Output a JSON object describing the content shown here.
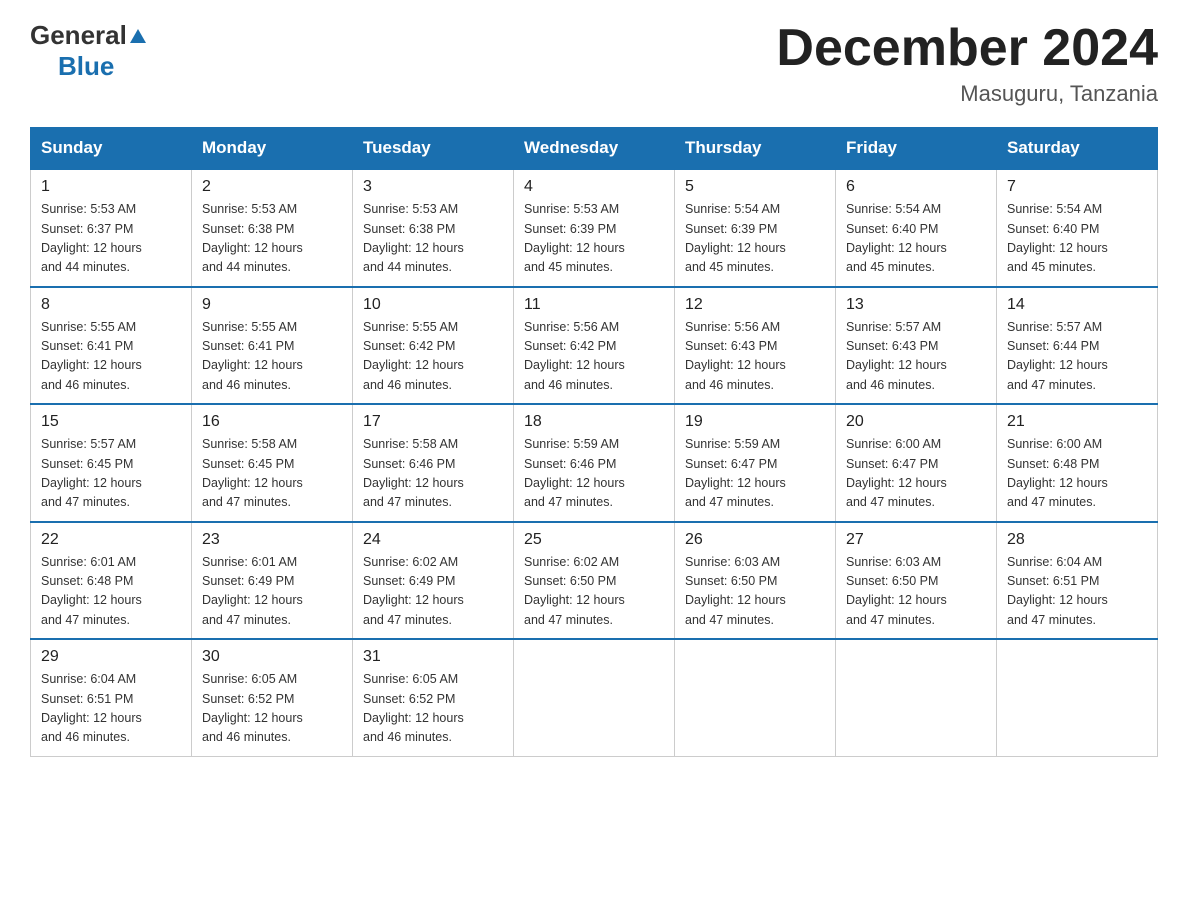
{
  "header": {
    "logo_general": "General",
    "logo_blue": "Blue",
    "month_year": "December 2024",
    "location": "Masuguru, Tanzania"
  },
  "columns": [
    "Sunday",
    "Monday",
    "Tuesday",
    "Wednesday",
    "Thursday",
    "Friday",
    "Saturday"
  ],
  "weeks": [
    [
      {
        "day": "1",
        "sunrise": "5:53 AM",
        "sunset": "6:37 PM",
        "daylight": "12 hours and 44 minutes."
      },
      {
        "day": "2",
        "sunrise": "5:53 AM",
        "sunset": "6:38 PM",
        "daylight": "12 hours and 44 minutes."
      },
      {
        "day": "3",
        "sunrise": "5:53 AM",
        "sunset": "6:38 PM",
        "daylight": "12 hours and 44 minutes."
      },
      {
        "day": "4",
        "sunrise": "5:53 AM",
        "sunset": "6:39 PM",
        "daylight": "12 hours and 45 minutes."
      },
      {
        "day": "5",
        "sunrise": "5:54 AM",
        "sunset": "6:39 PM",
        "daylight": "12 hours and 45 minutes."
      },
      {
        "day": "6",
        "sunrise": "5:54 AM",
        "sunset": "6:40 PM",
        "daylight": "12 hours and 45 minutes."
      },
      {
        "day": "7",
        "sunrise": "5:54 AM",
        "sunset": "6:40 PM",
        "daylight": "12 hours and 45 minutes."
      }
    ],
    [
      {
        "day": "8",
        "sunrise": "5:55 AM",
        "sunset": "6:41 PM",
        "daylight": "12 hours and 46 minutes."
      },
      {
        "day": "9",
        "sunrise": "5:55 AM",
        "sunset": "6:41 PM",
        "daylight": "12 hours and 46 minutes."
      },
      {
        "day": "10",
        "sunrise": "5:55 AM",
        "sunset": "6:42 PM",
        "daylight": "12 hours and 46 minutes."
      },
      {
        "day": "11",
        "sunrise": "5:56 AM",
        "sunset": "6:42 PM",
        "daylight": "12 hours and 46 minutes."
      },
      {
        "day": "12",
        "sunrise": "5:56 AM",
        "sunset": "6:43 PM",
        "daylight": "12 hours and 46 minutes."
      },
      {
        "day": "13",
        "sunrise": "5:57 AM",
        "sunset": "6:43 PM",
        "daylight": "12 hours and 46 minutes."
      },
      {
        "day": "14",
        "sunrise": "5:57 AM",
        "sunset": "6:44 PM",
        "daylight": "12 hours and 47 minutes."
      }
    ],
    [
      {
        "day": "15",
        "sunrise": "5:57 AM",
        "sunset": "6:45 PM",
        "daylight": "12 hours and 47 minutes."
      },
      {
        "day": "16",
        "sunrise": "5:58 AM",
        "sunset": "6:45 PM",
        "daylight": "12 hours and 47 minutes."
      },
      {
        "day": "17",
        "sunrise": "5:58 AM",
        "sunset": "6:46 PM",
        "daylight": "12 hours and 47 minutes."
      },
      {
        "day": "18",
        "sunrise": "5:59 AM",
        "sunset": "6:46 PM",
        "daylight": "12 hours and 47 minutes."
      },
      {
        "day": "19",
        "sunrise": "5:59 AM",
        "sunset": "6:47 PM",
        "daylight": "12 hours and 47 minutes."
      },
      {
        "day": "20",
        "sunrise": "6:00 AM",
        "sunset": "6:47 PM",
        "daylight": "12 hours and 47 minutes."
      },
      {
        "day": "21",
        "sunrise": "6:00 AM",
        "sunset": "6:48 PM",
        "daylight": "12 hours and 47 minutes."
      }
    ],
    [
      {
        "day": "22",
        "sunrise": "6:01 AM",
        "sunset": "6:48 PM",
        "daylight": "12 hours and 47 minutes."
      },
      {
        "day": "23",
        "sunrise": "6:01 AM",
        "sunset": "6:49 PM",
        "daylight": "12 hours and 47 minutes."
      },
      {
        "day": "24",
        "sunrise": "6:02 AM",
        "sunset": "6:49 PM",
        "daylight": "12 hours and 47 minutes."
      },
      {
        "day": "25",
        "sunrise": "6:02 AM",
        "sunset": "6:50 PM",
        "daylight": "12 hours and 47 minutes."
      },
      {
        "day": "26",
        "sunrise": "6:03 AM",
        "sunset": "6:50 PM",
        "daylight": "12 hours and 47 minutes."
      },
      {
        "day": "27",
        "sunrise": "6:03 AM",
        "sunset": "6:50 PM",
        "daylight": "12 hours and 47 minutes."
      },
      {
        "day": "28",
        "sunrise": "6:04 AM",
        "sunset": "6:51 PM",
        "daylight": "12 hours and 47 minutes."
      }
    ],
    [
      {
        "day": "29",
        "sunrise": "6:04 AM",
        "sunset": "6:51 PM",
        "daylight": "12 hours and 46 minutes."
      },
      {
        "day": "30",
        "sunrise": "6:05 AM",
        "sunset": "6:52 PM",
        "daylight": "12 hours and 46 minutes."
      },
      {
        "day": "31",
        "sunrise": "6:05 AM",
        "sunset": "6:52 PM",
        "daylight": "12 hours and 46 minutes."
      },
      null,
      null,
      null,
      null
    ]
  ],
  "labels": {
    "sunrise": "Sunrise:",
    "sunset": "Sunset:",
    "daylight": "Daylight:"
  }
}
